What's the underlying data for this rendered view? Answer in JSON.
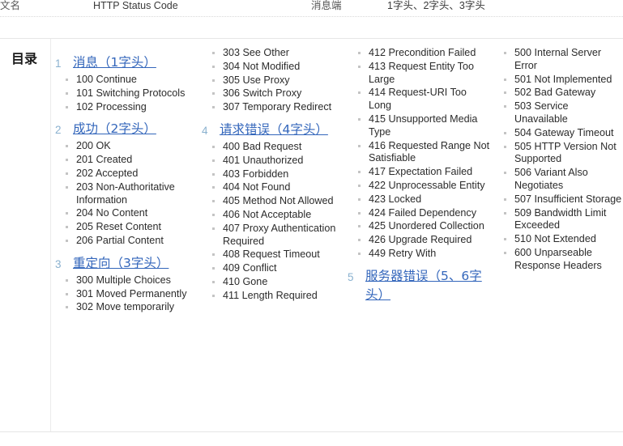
{
  "infobox": {
    "label_left": "文名",
    "value_left": "HTTP Status Code",
    "label_right": "消息端",
    "value_right": "1字头、2字头、3字头"
  },
  "toc": {
    "title": "目录",
    "columns": [
      {
        "entries": [
          {
            "kind": "heading",
            "num": "1",
            "text": "消息（1字头）"
          },
          {
            "kind": "item",
            "text": "100 Continue"
          },
          {
            "kind": "item",
            "text": "101 Switching Protocols"
          },
          {
            "kind": "item",
            "text": "102 Processing"
          },
          {
            "kind": "heading",
            "num": "2",
            "text": "成功（2字头）"
          },
          {
            "kind": "item",
            "text": "200 OK"
          },
          {
            "kind": "item",
            "text": "201 Created"
          },
          {
            "kind": "item",
            "text": "202 Accepted"
          },
          {
            "kind": "item",
            "text": "203 Non-Authoritative Information"
          },
          {
            "kind": "item",
            "text": "204 No Content"
          },
          {
            "kind": "item",
            "text": "205 Reset Content"
          },
          {
            "kind": "item",
            "text": "206 Partial Content"
          },
          {
            "kind": "heading",
            "num": "3",
            "text": "重定向（3字头）"
          },
          {
            "kind": "item",
            "text": "300 Multiple Choices"
          },
          {
            "kind": "item",
            "text": "301 Moved Permanently"
          },
          {
            "kind": "item",
            "text": "302 Move temporarily"
          }
        ]
      },
      {
        "entries": [
          {
            "kind": "item",
            "text": "303 See Other"
          },
          {
            "kind": "item",
            "text": "304 Not Modified"
          },
          {
            "kind": "item",
            "text": "305 Use Proxy"
          },
          {
            "kind": "item",
            "text": "306 Switch Proxy"
          },
          {
            "kind": "item",
            "text": "307 Temporary Redirect"
          },
          {
            "kind": "heading",
            "num": "4",
            "text": "请求错误（4字头）"
          },
          {
            "kind": "item",
            "text": "400 Bad Request"
          },
          {
            "kind": "item",
            "text": "401 Unauthorized"
          },
          {
            "kind": "item",
            "text": "403 Forbidden"
          },
          {
            "kind": "item",
            "text": "404 Not Found"
          },
          {
            "kind": "item",
            "text": "405 Method Not Allowed"
          },
          {
            "kind": "item",
            "text": "406 Not Acceptable"
          },
          {
            "kind": "item",
            "text": "407 Proxy Authentication Required"
          },
          {
            "kind": "item",
            "text": "408 Request Timeout"
          },
          {
            "kind": "item",
            "text": "409 Conflict"
          },
          {
            "kind": "item",
            "text": "410 Gone"
          },
          {
            "kind": "item",
            "text": "411 Length Required"
          }
        ]
      },
      {
        "entries": [
          {
            "kind": "item",
            "text": "412 Precondition Failed"
          },
          {
            "kind": "item",
            "text": "413 Request Entity Too Large"
          },
          {
            "kind": "item",
            "text": "414 Request-URI Too Long"
          },
          {
            "kind": "item",
            "text": "415 Unsupported Media Type"
          },
          {
            "kind": "item",
            "text": "416 Requested Range Not Satisfiable"
          },
          {
            "kind": "item",
            "text": "417 Expectation Failed"
          },
          {
            "kind": "item",
            "text": "422 Unprocessable Entity"
          },
          {
            "kind": "item",
            "text": "423 Locked"
          },
          {
            "kind": "item",
            "text": "424 Failed Dependency"
          },
          {
            "kind": "item",
            "text": "425 Unordered Collection"
          },
          {
            "kind": "item",
            "text": "426 Upgrade Required"
          },
          {
            "kind": "item",
            "text": "449 Retry With"
          },
          {
            "kind": "heading",
            "num": "5",
            "text": "服务器错误（5、6字头）"
          }
        ]
      },
      {
        "entries": [
          {
            "kind": "item",
            "text": "500 Internal Server Error"
          },
          {
            "kind": "item",
            "text": "501 Not Implemented"
          },
          {
            "kind": "item",
            "text": "502 Bad Gateway"
          },
          {
            "kind": "item",
            "text": "503 Service Unavailable"
          },
          {
            "kind": "item",
            "text": "504 Gateway Timeout"
          },
          {
            "kind": "item",
            "text": "505 HTTP Version Not Supported"
          },
          {
            "kind": "item",
            "text": "506 Variant Also Negotiates"
          },
          {
            "kind": "item",
            "text": "507 Insufficient Storage"
          },
          {
            "kind": "item",
            "text": "509 Bandwidth Limit Exceeded"
          },
          {
            "kind": "item",
            "text": "510 Not Extended"
          },
          {
            "kind": "item",
            "text": "600 Unparseable Response Headers"
          }
        ]
      }
    ]
  },
  "colors": {
    "link": "#3366bb",
    "number": "#8ab1cf",
    "bullet": "#c4c4c4",
    "border": "#e6e6e6",
    "text": "#2b2b2b"
  }
}
